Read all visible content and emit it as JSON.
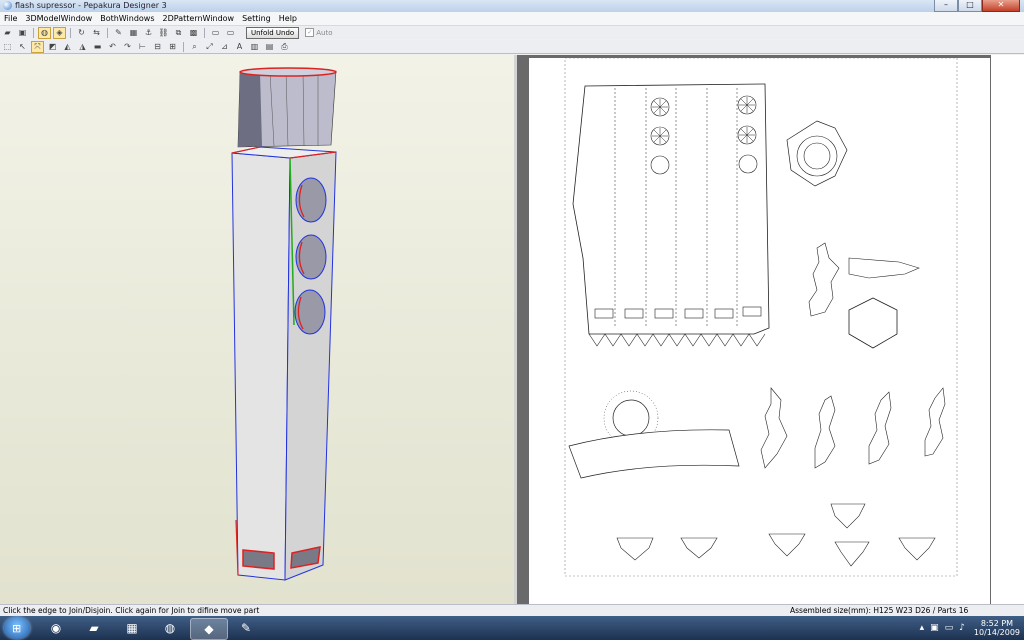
{
  "window": {
    "title": "flash supressor - Pepakura Designer 3",
    "minimize": "–",
    "maximize": "□",
    "close": "✕"
  },
  "menu": [
    "File",
    "3DModelWindow",
    "BothWindows",
    "2DPatternWindow",
    "Setting",
    "Help"
  ],
  "toolbar": {
    "unfold_undo": "Unfold Undo",
    "auto_label": "Auto"
  },
  "status": {
    "hint": "Click the edge to Join/Disjoin. Click again for Join to difine move part",
    "assembled": "Assembled size(mm): H125 W23 D26 / Parts 16"
  },
  "taskbar": {
    "apps": [
      "start-orb",
      "firefox",
      "explorer",
      "calendar",
      "media-center",
      "pepakura",
      "paint"
    ],
    "clock_time": "8:52 PM",
    "clock_date": "10/14/2009"
  },
  "colors": {
    "model_face": "#d8d8d8",
    "edge_blue": "#2233dd",
    "edge_red": "#dd2222",
    "edge_green": "#22aa22"
  }
}
